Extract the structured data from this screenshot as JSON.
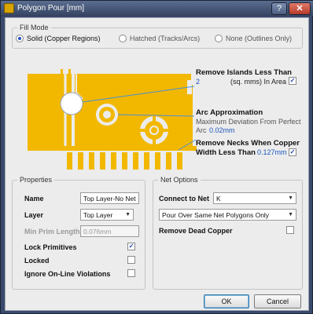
{
  "window": {
    "title": "Polygon Pour [mm]"
  },
  "fill_mode": {
    "legend": "Fill Mode",
    "options": [
      {
        "label": "Solid (Copper Regions)",
        "selected": true
      },
      {
        "label": "Hatched (Tracks/Arcs)",
        "selected": false
      },
      {
        "label": "None (Outlines Only)",
        "selected": false
      }
    ]
  },
  "remove_islands": {
    "title": "Remove Islands Less Than",
    "value": "2",
    "unit": "(sq. mms) In Area",
    "checked": true
  },
  "arc_approx": {
    "title": "Arc Approximation",
    "desc": "Maximum Deviation From Perfect",
    "arc_label": "Arc",
    "value": "0.02mm"
  },
  "remove_necks": {
    "title_line1": "Remove Necks When Copper",
    "title_line2": "Width Less Than",
    "value": "0.127mm",
    "checked": true
  },
  "properties": {
    "legend": "Properties",
    "name_label": "Name",
    "name_value": "Top Layer-No Net",
    "layer_label": "Layer",
    "layer_value": "Top Layer",
    "min_prim_label": "Min Prim Length",
    "min_prim_value": "0.076mm",
    "lock_primitives_label": "Lock Primitives",
    "lock_primitives_checked": true,
    "locked_label": "Locked",
    "locked_checked": false,
    "ignore_label": "Ignore On-Line Violations",
    "ignore_checked": false
  },
  "net_options": {
    "legend": "Net Options",
    "connect_label": "Connect to Net",
    "connect_value": "K",
    "pour_mode_value": "Pour Over Same Net Polygons Only",
    "remove_dead_label": "Remove Dead Copper",
    "remove_dead_checked": false
  },
  "buttons": {
    "ok": "OK",
    "cancel": "Cancel"
  },
  "colors": {
    "copper": "#f2b800",
    "accent_blue": "#1a56c0",
    "title_bar": "#34425f"
  }
}
